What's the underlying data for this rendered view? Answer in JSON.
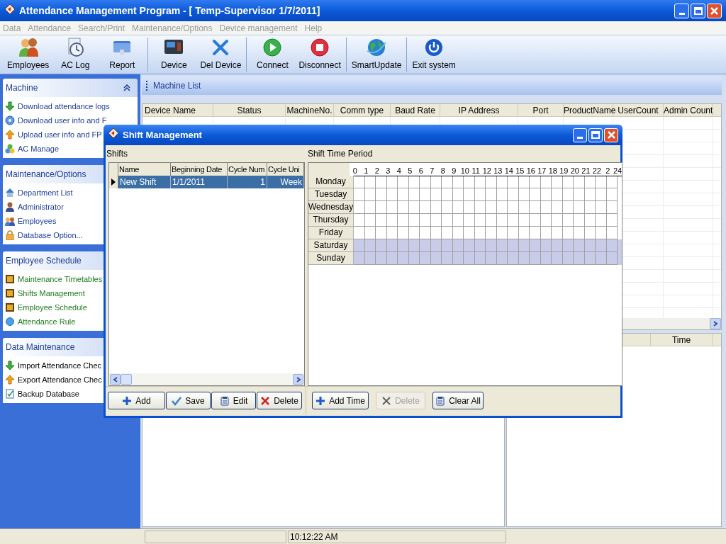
{
  "window": {
    "title": "Attendance Management Program - [ Temp-Supervisor 1/7/2011]"
  },
  "menu": [
    {
      "label": "Data",
      "disabled": true
    },
    {
      "label": "Attendance",
      "disabled": true
    },
    {
      "label": "Search/Print",
      "disabled": true
    },
    {
      "label": "Maintenance/Options",
      "disabled": true
    },
    {
      "label": "Device management",
      "disabled": true
    },
    {
      "label": "Help",
      "disabled": true
    }
  ],
  "toolbar": {
    "groups": [
      [
        {
          "label": "Employees"
        },
        {
          "label": "AC Log"
        },
        {
          "label": "Report"
        }
      ],
      [
        {
          "label": "Device"
        },
        {
          "label": "Del Device"
        }
      ],
      [
        {
          "label": "Connect"
        },
        {
          "label": "Disconnect"
        }
      ],
      [
        {
          "label": "SmartUpdate"
        }
      ],
      [
        {
          "label": "Exit system"
        }
      ]
    ]
  },
  "sidebar": {
    "sections": [
      {
        "title": "Machine",
        "collapse_button": true,
        "items": [
          "Download attendance logs",
          "Download user info and F",
          "Upload user info and FP",
          "AC Manage"
        ]
      },
      {
        "title": "Maintenance/Options",
        "items": [
          "Department List",
          "Administrator",
          "Employees",
          "Database Option..."
        ]
      },
      {
        "title": "Employee Schedule",
        "items": [
          "Maintenance Timetables",
          "Shifts Management",
          "Employee Schedule",
          "Attendance Rule"
        ]
      },
      {
        "title": "Data Maintenance",
        "items": [
          "Import Attendance Chec",
          "Export Attendance Chec",
          "Backup Database"
        ]
      }
    ]
  },
  "machine_list": {
    "title": "Machine List",
    "columns": [
      "Device Name",
      "Status",
      "MachineNo.",
      "Comm type",
      "Baud Rate",
      "IP Address",
      "Port",
      "ProductName",
      "UserCount",
      "Admin Count"
    ]
  },
  "log_panel": {
    "columns": [
      "Time"
    ]
  },
  "status_bar": {
    "time": "10:12:22 AM"
  },
  "dialog": {
    "title": "Shift Management",
    "shifts": {
      "label": "Shifts",
      "columns": [
        "Name",
        "Beginning Date",
        "Cycle Num",
        "Cycle Uni"
      ],
      "rows": [
        {
          "cells": [
            "New Shift",
            "1/1/2011",
            "1",
            "Week"
          ],
          "selected": true
        }
      ]
    },
    "time_period": {
      "label": "Shift Time Period",
      "hours": [
        "0",
        "1",
        "2",
        "3",
        "4",
        "5",
        "6",
        "7",
        "8",
        "9",
        "10",
        "11",
        "12",
        "13",
        "14",
        "15",
        "16",
        "17",
        "18",
        "19",
        "20",
        "21",
        "22",
        "2",
        "24"
      ],
      "days": [
        {
          "label": "Monday",
          "shaded": false
        },
        {
          "label": "Tuesday",
          "shaded": false
        },
        {
          "label": "Wednesday",
          "shaded": false
        },
        {
          "label": "Thursday",
          "shaded": false
        },
        {
          "label": "Friday",
          "shaded": false
        },
        {
          "label": "Saturday",
          "shaded": true
        },
        {
          "label": "Sunday",
          "shaded": true
        }
      ]
    },
    "shift_buttons": [
      {
        "label": "Add",
        "kind": "add",
        "disabled": false
      },
      {
        "label": "Save",
        "kind": "save",
        "disabled": false
      },
      {
        "label": "Edit",
        "kind": "edit",
        "disabled": false
      },
      {
        "label": "Delete",
        "kind": "delete",
        "disabled": false
      }
    ],
    "time_buttons": [
      {
        "label": "Add Time",
        "kind": "add",
        "disabled": false
      },
      {
        "label": "Delete",
        "kind": "delete",
        "disabled": true
      },
      {
        "label": "Clear All",
        "kind": "clear",
        "disabled": false
      }
    ]
  }
}
